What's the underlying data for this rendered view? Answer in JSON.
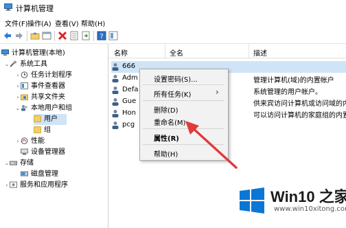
{
  "window": {
    "title": "计算机管理"
  },
  "menubar": {
    "items": [
      "文件(F)",
      "操作(A)",
      "查看(V)",
      "帮助(H)"
    ]
  },
  "toolbar": {
    "buttons": [
      "back-arrow-icon",
      "forward-arrow-icon",
      "folder-up-icon",
      "properties-icon",
      "delete-icon",
      "export-list-icon",
      "refresh-icon",
      "help-icon",
      "show-hide-icon"
    ]
  },
  "tree": {
    "root": "计算机管理(本地)",
    "items": [
      {
        "label": "系统工具"
      },
      {
        "label": "任务计划程序"
      },
      {
        "label": "事件查看器"
      },
      {
        "label": "共享文件夹"
      },
      {
        "label": "本地用户和组"
      },
      {
        "label": "用户"
      },
      {
        "label": "组"
      },
      {
        "label": "性能"
      },
      {
        "label": "设备管理器"
      },
      {
        "label": "存储"
      },
      {
        "label": "磁盘管理"
      },
      {
        "label": "服务和应用程序"
      }
    ]
  },
  "list": {
    "columns": [
      "名称",
      "全名",
      "描述"
    ],
    "rows": [
      {
        "name": "666",
        "full": "",
        "desc": ""
      },
      {
        "name": "Adm",
        "full": "",
        "desc": "管理计算机(域)的内置帐户"
      },
      {
        "name": "Defa",
        "full": "",
        "desc": "系统管理的用户帐户。"
      },
      {
        "name": "Gue",
        "full": "",
        "desc": "供来宾访问计算机或访问域的内"
      },
      {
        "name": "Hon",
        "full": "",
        "desc": "可以访问计算机的家庭组的内置"
      },
      {
        "name": "pcg",
        "full": "",
        "desc": ""
      }
    ]
  },
  "context_menu": {
    "items": [
      "设置密码(S)...",
      "所有任务(K)",
      "删除(D)",
      "重命名(M)",
      "属性(R)",
      "帮助(H)"
    ],
    "submenu_arrow": "›"
  },
  "watermark": {
    "title": "Win10 之家",
    "url": "www.win10xitong.com"
  },
  "colors": {
    "arrow": "#e03a3a",
    "selection": "#cfe5f7",
    "win_blue": "#0a76d6"
  }
}
